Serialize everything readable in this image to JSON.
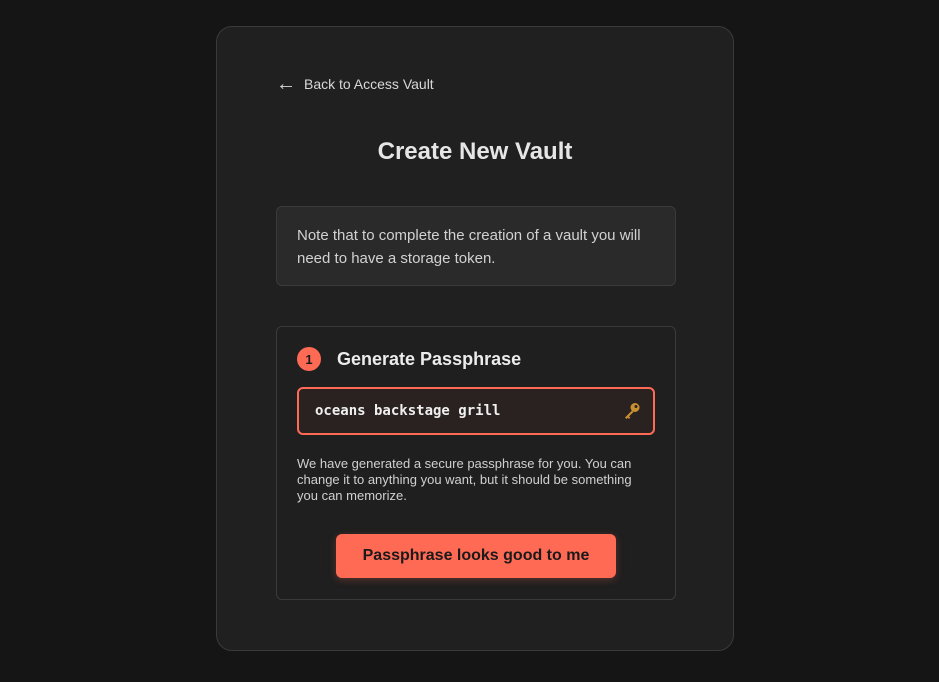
{
  "back_link": {
    "arrow_icon": "arrow-left-icon",
    "label": "Back to Access Vault"
  },
  "title": "Create New Vault",
  "note": "Note that to complete the creation of a vault you will need to have a storage token.",
  "step": {
    "number": "1",
    "title": "Generate Passphrase",
    "passphrase_value": "oceans backstage grill",
    "field_icon": "key-icon",
    "help_text": "We have generated a secure passphrase for you. You can change it to anything you want, but it should be something you can memorize.",
    "confirm_button": "Passphrase looks good to me"
  },
  "colors": {
    "accent": "#ff6a55",
    "background": "#151515",
    "card": "#202020"
  }
}
